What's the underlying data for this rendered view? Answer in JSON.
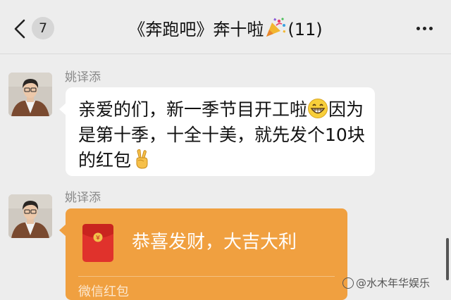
{
  "header": {
    "unread_count": "7",
    "title_prefix": "《奔跑吧》奔十啦",
    "title_suffix": "(11)",
    "title_icon": "party-popper-icon",
    "back_icon": "chevron-left-icon",
    "more_icon": "more-dots-icon"
  },
  "messages": [
    {
      "sender": "姚译添",
      "type": "text",
      "text_part1": "亲爱的们，新一季节目开工啦",
      "emoji1": "grinning-face-emoji",
      "text_part2": "因为是第十季，十全十美，就先发个10块的红包",
      "emoji2": "victory-hand-emoji"
    },
    {
      "sender": "姚译添",
      "type": "red_packet",
      "greeting": "恭喜发财，大吉大利",
      "label": "微信红包",
      "icon": "red-envelope-icon"
    }
  ],
  "watermark": "@水木年华娱乐",
  "colors": {
    "background": "#ededed",
    "bubble": "#ffffff",
    "red_packet": "#f0a040",
    "envelope_red": "#e0322c",
    "sender_name": "#8a8a8a"
  }
}
